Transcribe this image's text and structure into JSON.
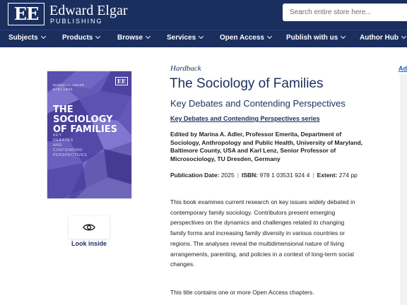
{
  "brand": {
    "logo_mark": "EE",
    "name": "Edward Elgar",
    "sub": "PUBLISHING"
  },
  "search": {
    "placeholder": "Search entire store here..."
  },
  "nav": {
    "items": [
      {
        "label": "Subjects"
      },
      {
        "label": "Products"
      },
      {
        "label": "Browse"
      },
      {
        "label": "Services"
      },
      {
        "label": "Open Access"
      },
      {
        "label": "Publish with us"
      },
      {
        "label": "Author Hub"
      }
    ]
  },
  "cover": {
    "logo": "EE",
    "authors": "MARINA A. ADLER\nKARL LENZ",
    "title": "THE SOCIOLOGY\nOF FAMILIES",
    "subtitle": "KEY\nDEBATES\nAND\nCONTENDING\nPERSPECTIVES",
    "colors": {
      "base": "#6559b8",
      "dark": "#3d3388",
      "light": "#8e83d6"
    }
  },
  "look_inside": {
    "label": "Look inside",
    "icon": "eye-icon"
  },
  "product": {
    "format": "Hardback",
    "title": "The Sociology of Families",
    "subtitle": "Key Debates and Contending Perspectives",
    "series": "Key Debates and Contending Perspectives series",
    "editors": "Edited by Marina A. Adler, Professor Emerita, Department of Sociology, Anthropology and Public Health, University of Maryland, Baltimore County, USA and Karl Lenz, Senior Professor of Microsociology, TU Dresden, Germany",
    "publication_date_label": "Publication Date:",
    "publication_date": "2025",
    "isbn_label": "ISBN:",
    "isbn": "978 1 03531 924 4",
    "extent_label": "Extent:",
    "extent": "274 pp",
    "description": "This book examines current research on key issues widely debated in contemporary family sociology. Contributors present emerging perspectives on the dynamics and challenges related to changing family forms and increasing family diversity in various countries or regions. The analyses reveal the multidimensional nature of living arrangements, parenting, and policies in a context of long-term social changes.",
    "open_access_note": "This title contains one or more Open Access chapters."
  },
  "side": {
    "link": "Ad"
  },
  "colors": {
    "navy": "#1b2f5e",
    "link_blue": "#1b5fbf"
  }
}
